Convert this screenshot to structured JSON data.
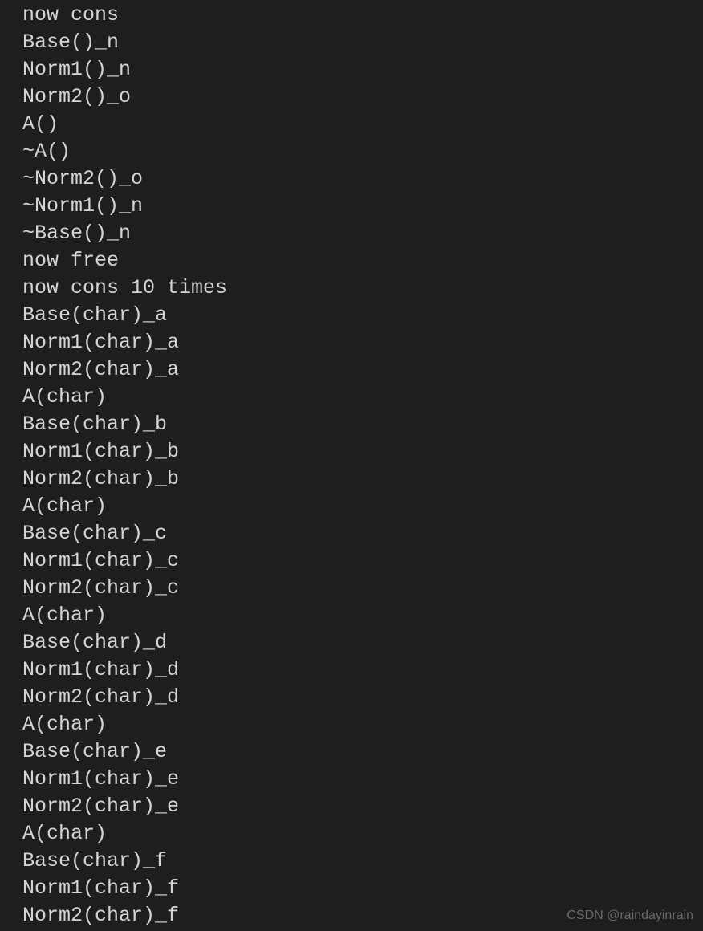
{
  "terminal": {
    "lines": [
      "now cons",
      "Base()_n",
      "Norm1()_n",
      "Norm2()_o",
      "A()",
      "~A()",
      "~Norm2()_o",
      "~Norm1()_n",
      "~Base()_n",
      "now free",
      "now cons 10 times",
      "Base(char)_a",
      "Norm1(char)_a",
      "Norm2(char)_a",
      "A(char)",
      "Base(char)_b",
      "Norm1(char)_b",
      "Norm2(char)_b",
      "A(char)",
      "Base(char)_c",
      "Norm1(char)_c",
      "Norm2(char)_c",
      "A(char)",
      "Base(char)_d",
      "Norm1(char)_d",
      "Norm2(char)_d",
      "A(char)",
      "Base(char)_e",
      "Norm1(char)_e",
      "Norm2(char)_e",
      "A(char)",
      "Base(char)_f",
      "Norm1(char)_f",
      "Norm2(char)_f"
    ]
  },
  "watermark": "CSDN @raindayinrain"
}
